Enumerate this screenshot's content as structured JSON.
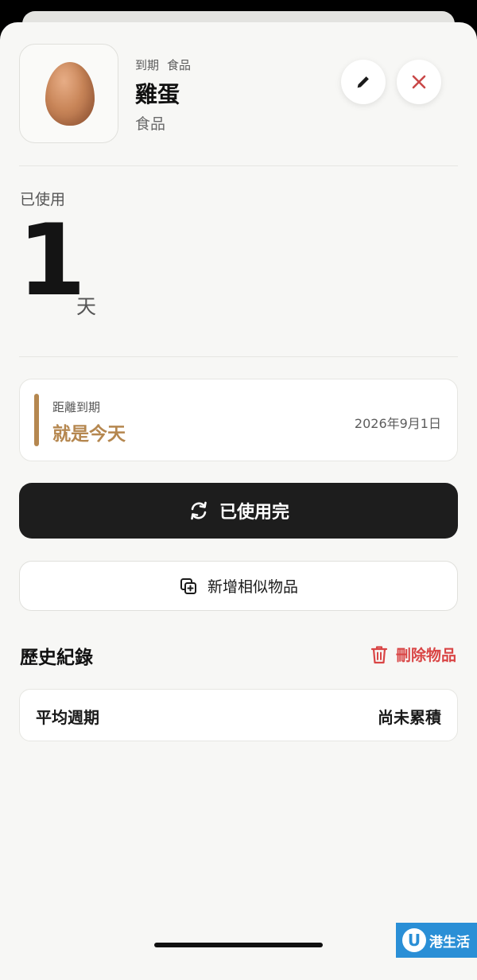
{
  "item": {
    "tags": [
      "到期",
      "食品"
    ],
    "name": "雞蛋",
    "category": "食品",
    "image_icon": "egg-icon"
  },
  "actions": {
    "edit_icon": "pencil-icon",
    "close_icon": "close-icon"
  },
  "usage": {
    "label": "已使用",
    "days": "1",
    "unit": "天"
  },
  "expiry": {
    "label": "距離到期",
    "status": "就是今天",
    "date": "2026年9月1日",
    "accent_color": "#b5874f"
  },
  "buttons": {
    "used_up_label": "已使用完",
    "add_similar_label": "新增相似物品"
  },
  "history": {
    "title": "歷史紀錄",
    "delete_label": "刪除物品",
    "delete_color": "#d94545",
    "stats": [
      {
        "label": "平均週期",
        "value": "尚未累積"
      }
    ]
  },
  "watermark": {
    "logo": "U",
    "text": "港生活"
  }
}
